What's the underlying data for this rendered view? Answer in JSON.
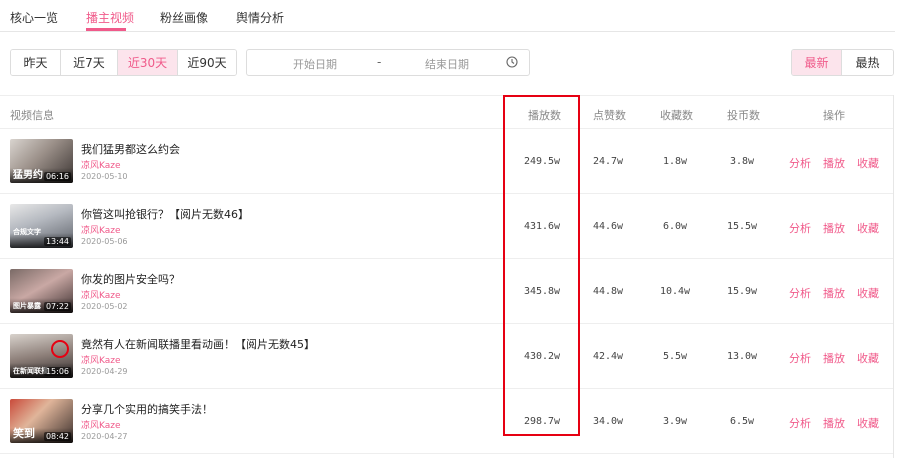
{
  "tabs": [
    "核心一览",
    "播主视频",
    "粉丝画像",
    "舆情分析"
  ],
  "range_buttons": [
    "昨天",
    "近7天",
    "近30天",
    "近90天"
  ],
  "date_range": {
    "start_placeholder": "开始日期",
    "separator": "-",
    "end_placeholder": "结束日期"
  },
  "sort_buttons": [
    "最新",
    "最热"
  ],
  "columns": [
    "视频信息",
    "播放数",
    "点赞数",
    "收藏数",
    "投币数",
    "操作"
  ],
  "actions": [
    "分析",
    "播放",
    "收藏"
  ],
  "videos": [
    {
      "title": "我们猛男都这么约会",
      "author": "凉风Kaze",
      "date": "2020-05-10",
      "thumb_tag": "猛男约",
      "duration": "06:16",
      "plays": "249.5w",
      "likes": "24.7w",
      "favorites": "1.8w",
      "coins": "3.8w"
    },
    {
      "title": "你管这叫抢银行？【阅片无数46】",
      "author": "凉风Kaze",
      "date": "2020-05-06",
      "thumb_tag": "合规文字",
      "duration": "13:44",
      "plays": "431.6w",
      "likes": "44.6w",
      "favorites": "6.0w",
      "coins": "15.5w"
    },
    {
      "title": "你发的图片安全吗？",
      "author": "凉风Kaze",
      "date": "2020-05-02",
      "thumb_tag": "图片暴露",
      "duration": "07:22",
      "plays": "345.8w",
      "likes": "44.8w",
      "favorites": "10.4w",
      "coins": "15.9w"
    },
    {
      "title": "竟然有人在新闻联播里看动画！【阅片无数45】",
      "author": "凉风Kaze",
      "date": "2020-04-29",
      "thumb_tag": "在新闻联播",
      "duration": "15:06",
      "plays": "430.2w",
      "likes": "42.4w",
      "favorites": "5.5w",
      "coins": "13.0w"
    },
    {
      "title": "分享几个实用的搞笑手法！",
      "author": "凉风Kaze",
      "date": "2020-04-27",
      "thumb_tag": "笑到",
      "duration": "08:42",
      "plays": "298.7w",
      "likes": "34.0w",
      "favorites": "3.9w",
      "coins": "6.5w"
    }
  ],
  "colors": {
    "accent": "#f05a8a",
    "highlight_border": "#e60012",
    "active_bg": "#fce4ec"
  }
}
